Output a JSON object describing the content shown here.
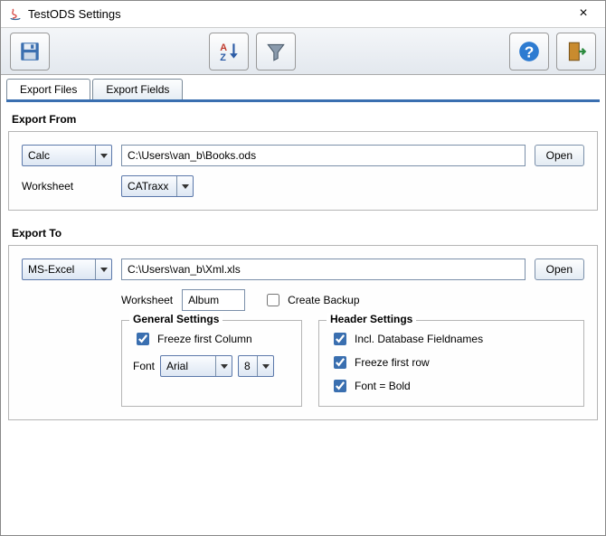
{
  "window": {
    "title": "TestODS Settings"
  },
  "tabs": [
    {
      "label": "Export Files"
    },
    {
      "label": "Export Fields"
    }
  ],
  "exportFrom": {
    "title": "Export From",
    "sourceType": "Calc",
    "path": "C:\\Users\\van_b\\Books.ods",
    "openLabel": "Open",
    "worksheetLabel": "Worksheet",
    "worksheet": "CATraxx"
  },
  "exportTo": {
    "title": "Export To",
    "targetType": "MS-Excel",
    "path": "C:\\Users\\van_b\\Xml.xls",
    "openLabel": "Open",
    "worksheetLabel": "Worksheet",
    "worksheet": "Album",
    "createBackupLabel": "Create Backup",
    "createBackup": false,
    "general": {
      "legend": "General Settings",
      "freezeFirstColumnLabel": "Freeze first Column",
      "freezeFirstColumn": true,
      "fontLabel": "Font",
      "font": "Arial",
      "fontSize": "8"
    },
    "header": {
      "legend": "Header Settings",
      "inclDbFieldnamesLabel": "Incl. Database Fieldnames",
      "inclDbFieldnames": true,
      "freezeFirstRowLabel": "Freeze first row",
      "freezeFirstRow": true,
      "fontBoldLabel": "Font = Bold",
      "fontBold": true
    }
  }
}
